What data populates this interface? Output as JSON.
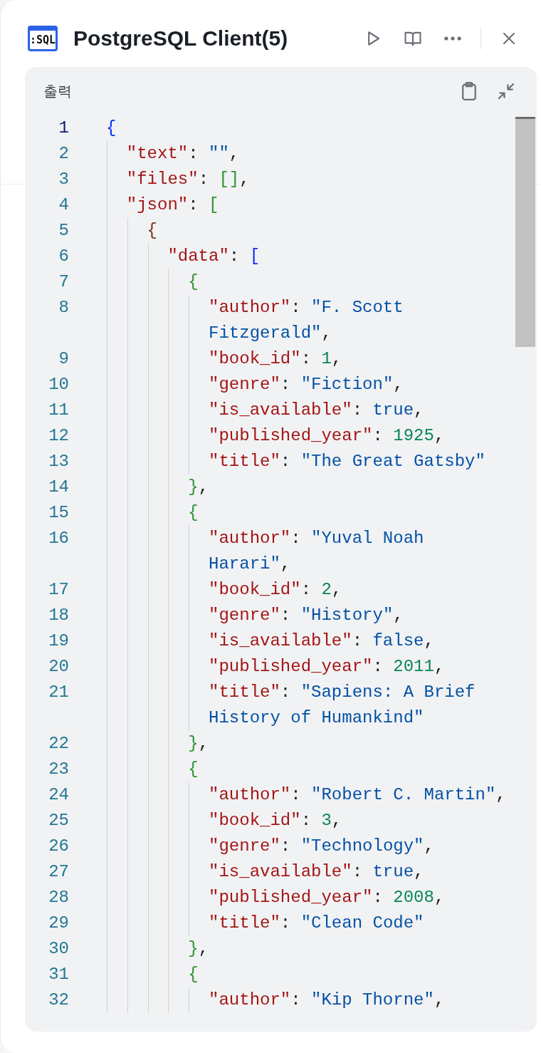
{
  "window": {
    "icon_text": ":SQL",
    "title": "PostgreSQL Client(5)"
  },
  "output": {
    "title": "출력",
    "lines": [
      {
        "number": "1",
        "current": true,
        "tokens": [
          {
            "kind": "bracket",
            "text": "{",
            "color": "#0431fa"
          }
        ]
      },
      {
        "number": "2",
        "current": false,
        "tokens": [
          {
            "kind": "key",
            "text": "\"text\""
          },
          {
            "kind": "punct",
            "text": ": "
          },
          {
            "kind": "str",
            "text": "\"\""
          },
          {
            "kind": "punct",
            "text": ","
          }
        ]
      },
      {
        "number": "3",
        "current": false,
        "tokens": [
          {
            "kind": "key",
            "text": "\"files\""
          },
          {
            "kind": "punct",
            "text": ": "
          },
          {
            "kind": "bracket",
            "text": "[]",
            "color": "#319331"
          },
          {
            "kind": "punct",
            "text": ","
          }
        ]
      },
      {
        "number": "4",
        "current": false,
        "tokens": [
          {
            "kind": "key",
            "text": "\"json\""
          },
          {
            "kind": "punct",
            "text": ": "
          },
          {
            "kind": "bracket",
            "text": "[",
            "color": "#319331"
          }
        ]
      },
      {
        "number": "5",
        "current": false,
        "tokens": [
          {
            "kind": "bracket",
            "text": "{",
            "color": "#7b3814"
          }
        ]
      },
      {
        "number": "6",
        "current": false,
        "tokens": [
          {
            "kind": "key",
            "text": "\"data\""
          },
          {
            "kind": "punct",
            "text": ": "
          },
          {
            "kind": "bracket",
            "text": "[",
            "color": "#0431fa"
          }
        ]
      },
      {
        "number": "7",
        "current": false,
        "tokens": [
          {
            "kind": "bracket",
            "text": "{",
            "color": "#319331"
          }
        ]
      },
      {
        "number": "8",
        "current": false,
        "tokens": [
          {
            "kind": "key",
            "text": "\"author\""
          },
          {
            "kind": "punct",
            "text": ": "
          },
          {
            "kind": "str",
            "text": "\"F. Scott Fitzgerald\""
          },
          {
            "kind": "punct",
            "text": ","
          }
        ]
      },
      {
        "number": "9",
        "current": false,
        "tokens": [
          {
            "kind": "key",
            "text": "\"book_id\""
          },
          {
            "kind": "punct",
            "text": ": "
          },
          {
            "kind": "num",
            "text": "1"
          },
          {
            "kind": "punct",
            "text": ","
          }
        ]
      },
      {
        "number": "10",
        "current": false,
        "tokens": [
          {
            "kind": "key",
            "text": "\"genre\""
          },
          {
            "kind": "punct",
            "text": ": "
          },
          {
            "kind": "str",
            "text": "\"Fiction\""
          },
          {
            "kind": "punct",
            "text": ","
          }
        ]
      },
      {
        "number": "11",
        "current": false,
        "tokens": [
          {
            "kind": "key",
            "text": "\"is_available\""
          },
          {
            "kind": "punct",
            "text": ": "
          },
          {
            "kind": "bool",
            "text": "true"
          },
          {
            "kind": "punct",
            "text": ","
          }
        ]
      },
      {
        "number": "12",
        "current": false,
        "tokens": [
          {
            "kind": "key",
            "text": "\"published_year\""
          },
          {
            "kind": "punct",
            "text": ": "
          },
          {
            "kind": "num",
            "text": "1925"
          },
          {
            "kind": "punct",
            "text": ","
          }
        ]
      },
      {
        "number": "13",
        "current": false,
        "tokens": [
          {
            "kind": "key",
            "text": "\"title\""
          },
          {
            "kind": "punct",
            "text": ": "
          },
          {
            "kind": "str",
            "text": "\"The Great Gatsby\""
          }
        ]
      },
      {
        "number": "14",
        "current": false,
        "tokens": [
          {
            "kind": "bracket",
            "text": "}",
            "color": "#319331"
          },
          {
            "kind": "punct",
            "text": ","
          }
        ]
      },
      {
        "number": "15",
        "current": false,
        "tokens": [
          {
            "kind": "bracket",
            "text": "{",
            "color": "#319331"
          }
        ]
      },
      {
        "number": "16",
        "current": false,
        "tokens": [
          {
            "kind": "key",
            "text": "\"author\""
          },
          {
            "kind": "punct",
            "text": ": "
          },
          {
            "kind": "str",
            "text": "\"Yuval Noah Harari\""
          },
          {
            "kind": "punct",
            "text": ","
          }
        ]
      },
      {
        "number": "17",
        "current": false,
        "tokens": [
          {
            "kind": "key",
            "text": "\"book_id\""
          },
          {
            "kind": "punct",
            "text": ": "
          },
          {
            "kind": "num",
            "text": "2"
          },
          {
            "kind": "punct",
            "text": ","
          }
        ]
      },
      {
        "number": "18",
        "current": false,
        "tokens": [
          {
            "kind": "key",
            "text": "\"genre\""
          },
          {
            "kind": "punct",
            "text": ": "
          },
          {
            "kind": "str",
            "text": "\"History\""
          },
          {
            "kind": "punct",
            "text": ","
          }
        ]
      },
      {
        "number": "19",
        "current": false,
        "tokens": [
          {
            "kind": "key",
            "text": "\"is_available\""
          },
          {
            "kind": "punct",
            "text": ": "
          },
          {
            "kind": "bool",
            "text": "false"
          },
          {
            "kind": "punct",
            "text": ","
          }
        ]
      },
      {
        "number": "20",
        "current": false,
        "tokens": [
          {
            "kind": "key",
            "text": "\"published_year\""
          },
          {
            "kind": "punct",
            "text": ": "
          },
          {
            "kind": "num",
            "text": "2011"
          },
          {
            "kind": "punct",
            "text": ","
          }
        ]
      },
      {
        "number": "21",
        "current": false,
        "tokens": [
          {
            "kind": "key",
            "text": "\"title\""
          },
          {
            "kind": "punct",
            "text": ": "
          },
          {
            "kind": "str",
            "text": "\"Sapiens: A Brief History of Humankind\""
          }
        ]
      },
      {
        "number": "22",
        "current": false,
        "tokens": [
          {
            "kind": "bracket",
            "text": "}",
            "color": "#319331"
          },
          {
            "kind": "punct",
            "text": ","
          }
        ]
      },
      {
        "number": "23",
        "current": false,
        "tokens": [
          {
            "kind": "bracket",
            "text": "{",
            "color": "#319331"
          }
        ]
      },
      {
        "number": "24",
        "current": false,
        "tokens": [
          {
            "kind": "key",
            "text": "\"author\""
          },
          {
            "kind": "punct",
            "text": ": "
          },
          {
            "kind": "str",
            "text": "\"Robert C. Martin\""
          },
          {
            "kind": "punct",
            "text": ","
          }
        ]
      },
      {
        "number": "25",
        "current": false,
        "tokens": [
          {
            "kind": "key",
            "text": "\"book_id\""
          },
          {
            "kind": "punct",
            "text": ": "
          },
          {
            "kind": "num",
            "text": "3"
          },
          {
            "kind": "punct",
            "text": ","
          }
        ]
      },
      {
        "number": "26",
        "current": false,
        "tokens": [
          {
            "kind": "key",
            "text": "\"genre\""
          },
          {
            "kind": "punct",
            "text": ": "
          },
          {
            "kind": "str",
            "text": "\"Technology\""
          },
          {
            "kind": "punct",
            "text": ","
          }
        ]
      },
      {
        "number": "27",
        "current": false,
        "tokens": [
          {
            "kind": "key",
            "text": "\"is_available\""
          },
          {
            "kind": "punct",
            "text": ": "
          },
          {
            "kind": "bool",
            "text": "true"
          },
          {
            "kind": "punct",
            "text": ","
          }
        ]
      },
      {
        "number": "28",
        "current": false,
        "tokens": [
          {
            "kind": "key",
            "text": "\"published_year\""
          },
          {
            "kind": "punct",
            "text": ": "
          },
          {
            "kind": "num",
            "text": "2008"
          },
          {
            "kind": "punct",
            "text": ","
          }
        ]
      },
      {
        "number": "29",
        "current": false,
        "tokens": [
          {
            "kind": "key",
            "text": "\"title\""
          },
          {
            "kind": "punct",
            "text": ": "
          },
          {
            "kind": "str",
            "text": "\"Clean Code\""
          }
        ]
      },
      {
        "number": "30",
        "current": false,
        "tokens": [
          {
            "kind": "bracket",
            "text": "}",
            "color": "#319331"
          },
          {
            "kind": "punct",
            "text": ","
          }
        ]
      },
      {
        "number": "31",
        "current": false,
        "tokens": [
          {
            "kind": "bracket",
            "text": "{",
            "color": "#319331"
          }
        ]
      },
      {
        "number": "32",
        "current": false,
        "tokens": [
          {
            "kind": "key",
            "text": "\"author\""
          },
          {
            "kind": "punct",
            "text": ": "
          },
          {
            "kind": "str",
            "text": "\"Kip Thorne\""
          },
          {
            "kind": "punct",
            "text": ","
          }
        ]
      }
    ]
  }
}
